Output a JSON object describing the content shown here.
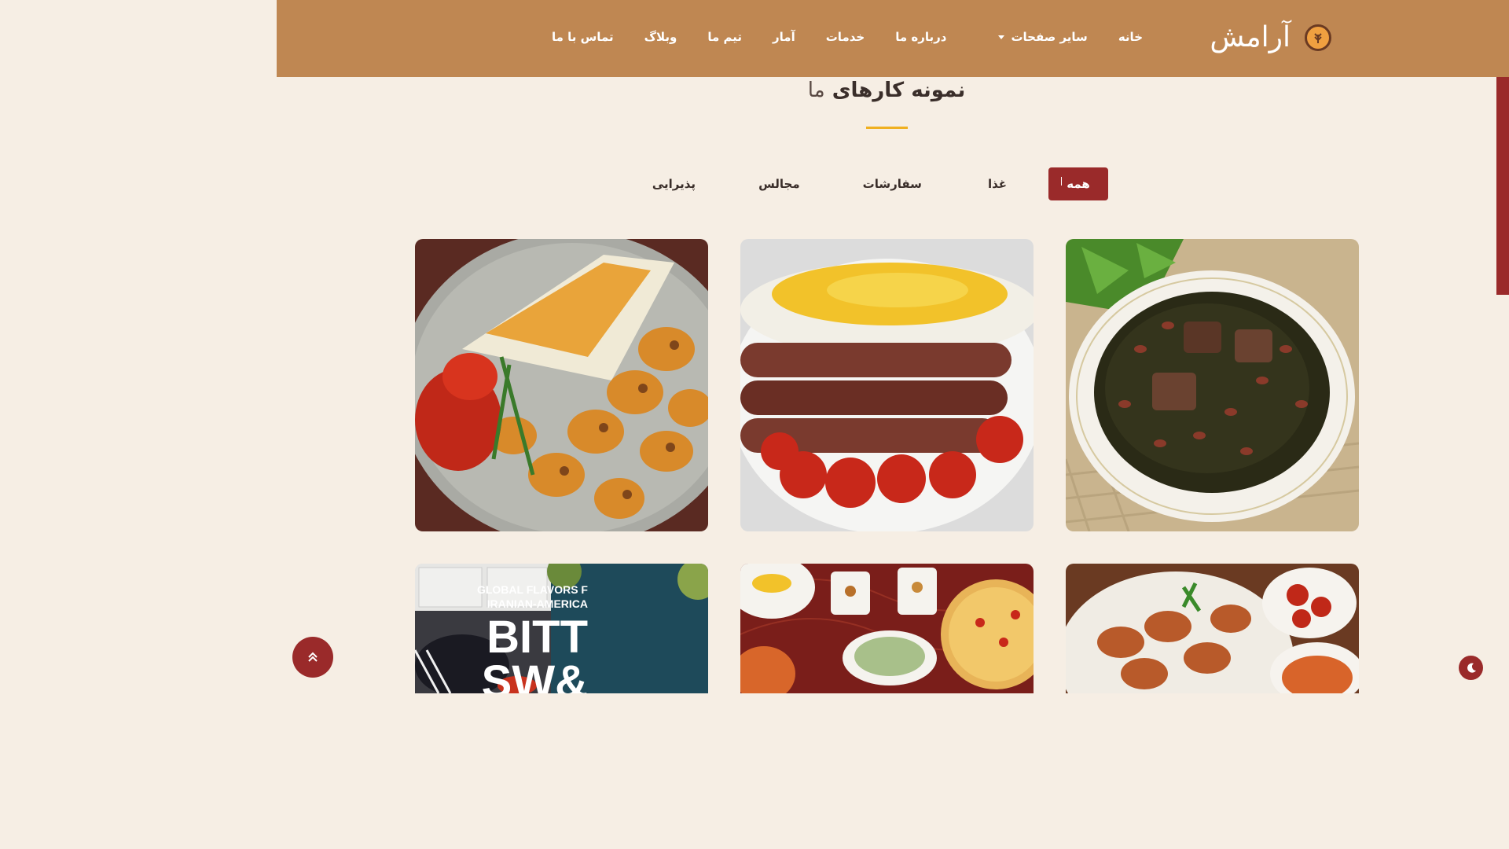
{
  "brand": {
    "name": "آرامش",
    "logo_icon": "wheat-logo-icon"
  },
  "nav": {
    "items": [
      {
        "label": "خانه"
      },
      {
        "label": "سایر صفحات",
        "dropdown": true
      },
      {
        "label": "درباره ما"
      },
      {
        "label": "خدمات"
      },
      {
        "label": "آمار"
      },
      {
        "label": "تیم ما"
      },
      {
        "label": "وبلاگ"
      },
      {
        "label": "تماس با ما"
      }
    ]
  },
  "portfolio": {
    "title_bold": "نمونه کارهای",
    "title_light": "ما",
    "filters": [
      {
        "label": "همه",
        "active": true
      },
      {
        "label": "غذا"
      },
      {
        "label": "سفارشات"
      },
      {
        "label": "مجالس"
      },
      {
        "label": "پذیرایی"
      }
    ],
    "items": [
      {
        "name": "ghormeh-sabzi-image"
      },
      {
        "name": "kabab-koobideh-image"
      },
      {
        "name": "joojeh-kabab-image"
      },
      {
        "name": "kabab-platter-image"
      },
      {
        "name": "persian-table-spread-image"
      },
      {
        "name": "cookbook-cover-image",
        "text_line1": "GLOBAL FLAVORS F",
        "text_line2": "IRANIAN-AMERICA",
        "text_big1": "BITT",
        "text_big2": "&SW"
      }
    ]
  },
  "colors": {
    "nav_bg": "#bf8752",
    "accent": "#9a2a2a",
    "underline": "#f0b020",
    "page_bg": "#f6eee4"
  },
  "icons": {
    "back_to_top": "double-chevron-up-icon",
    "dark_mode": "moon-icon"
  }
}
